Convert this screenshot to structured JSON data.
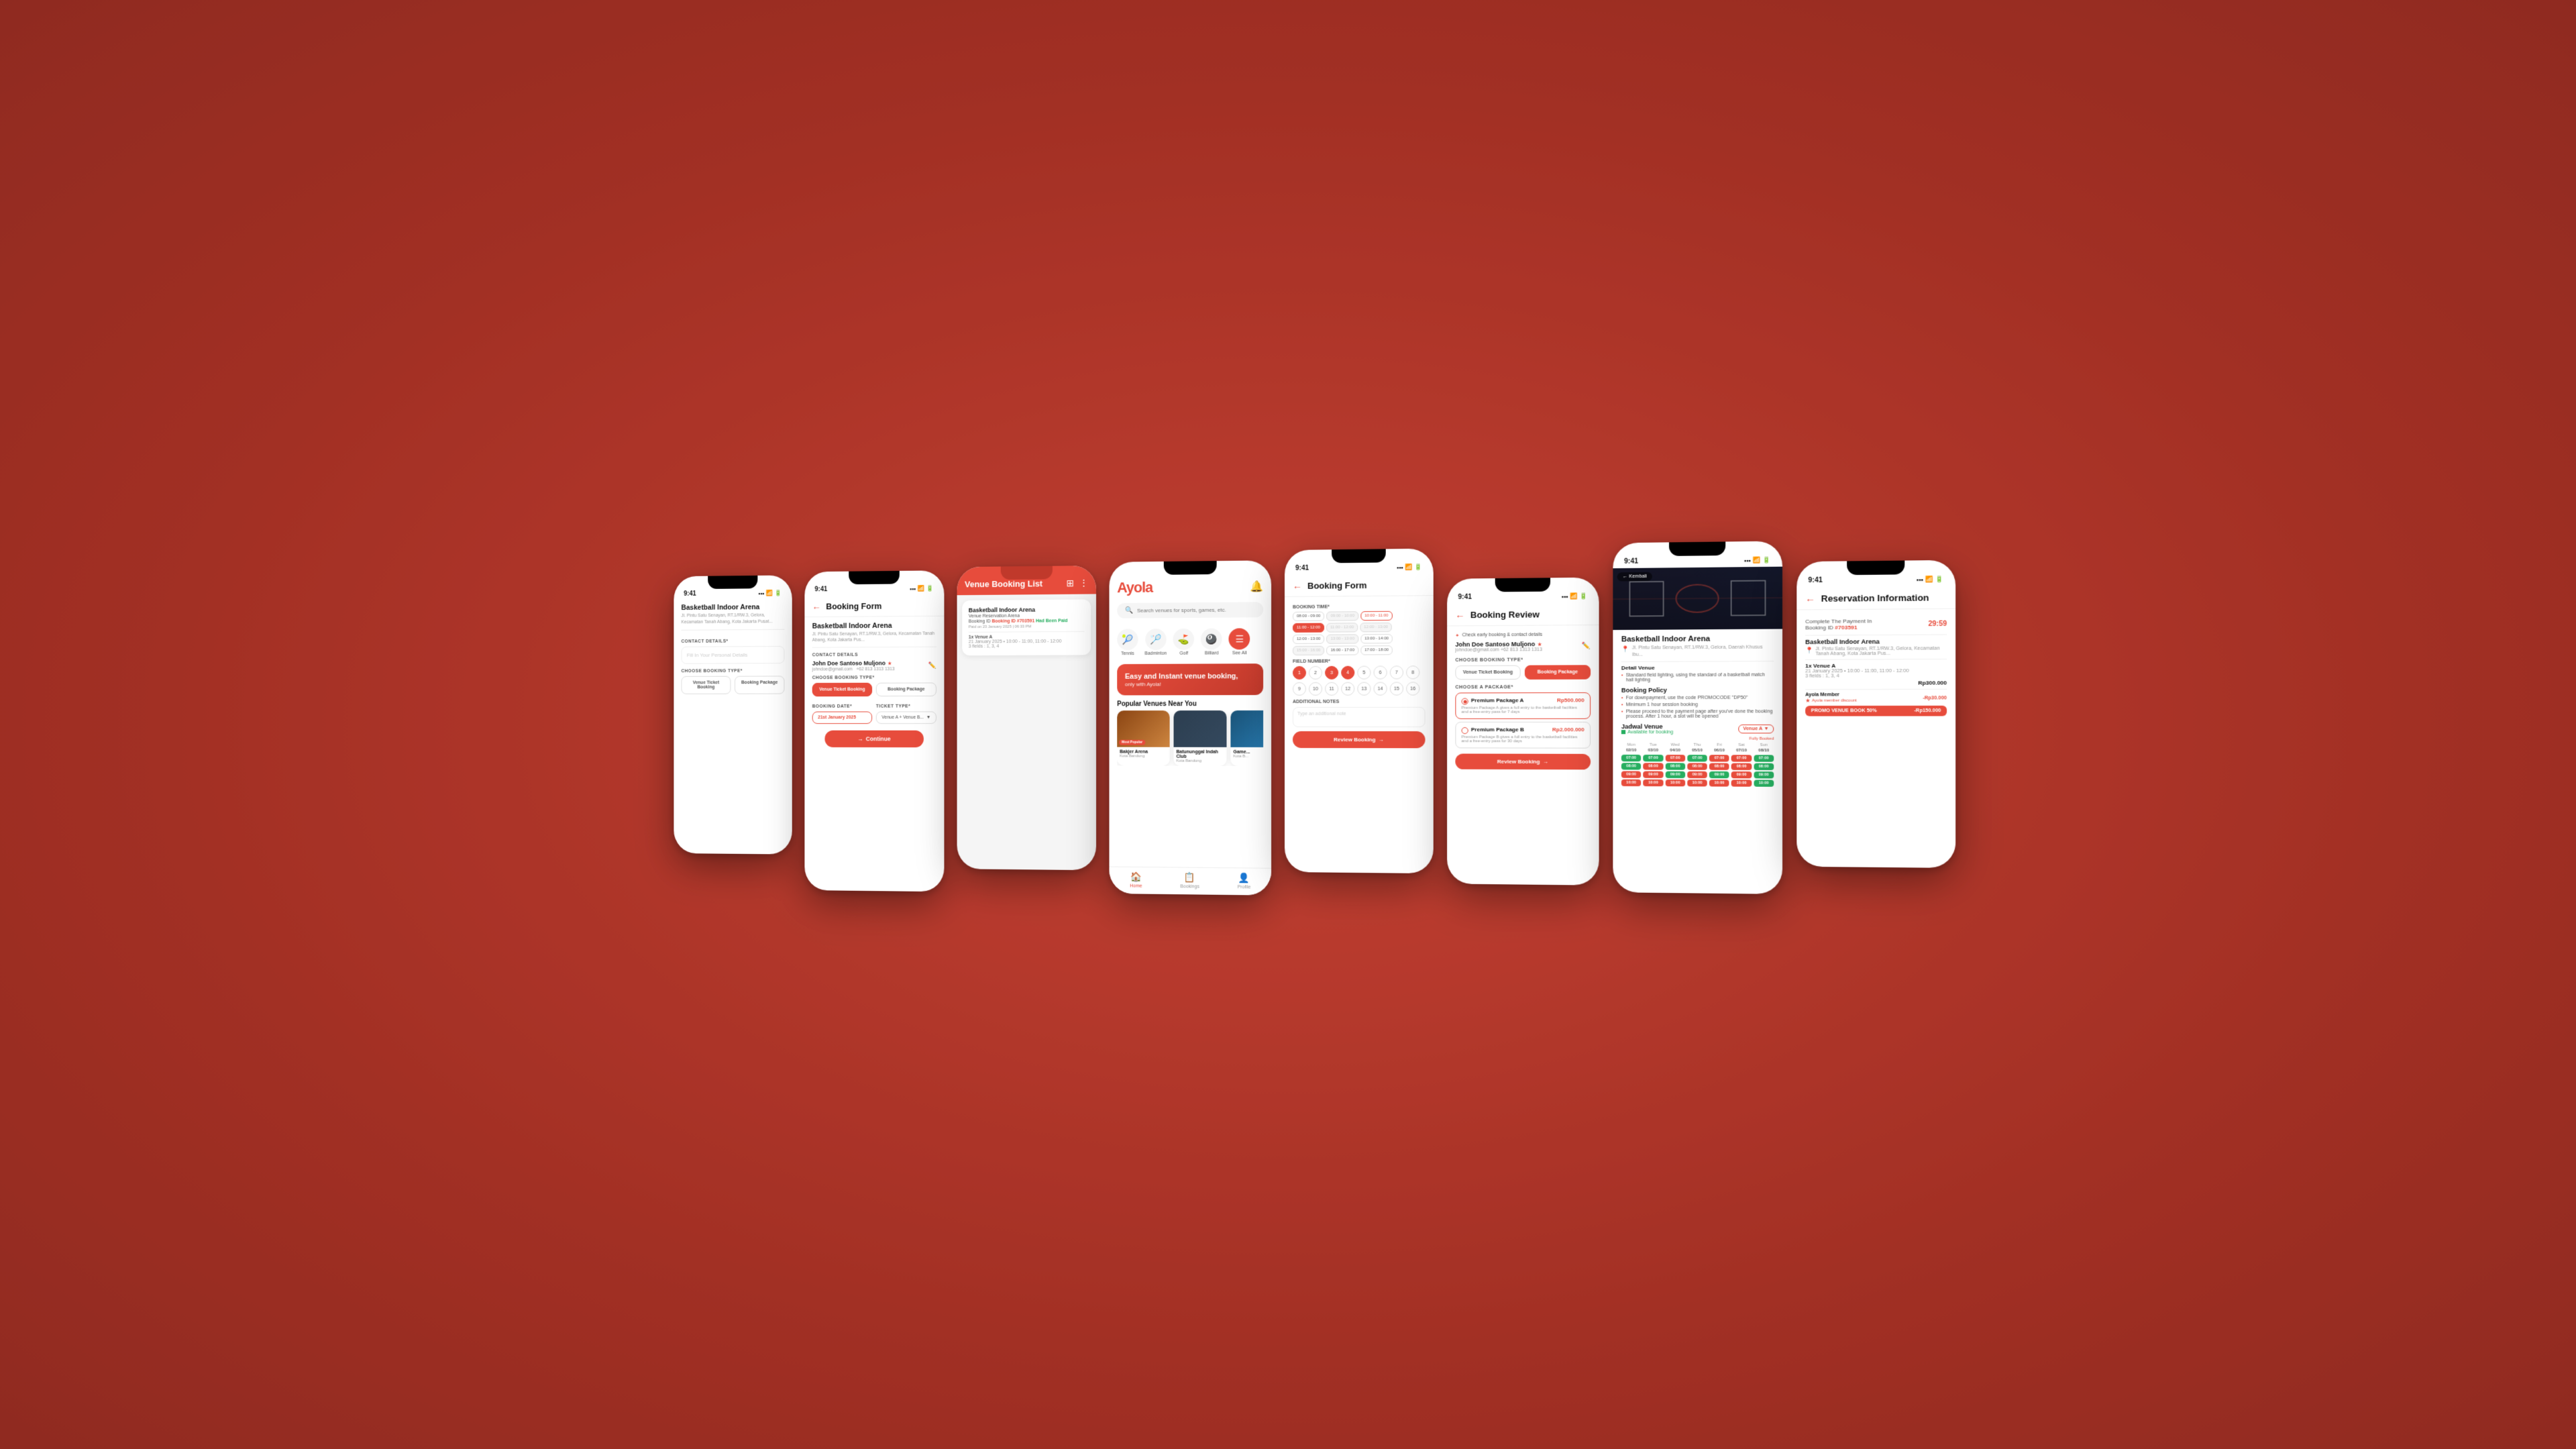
{
  "app": {
    "name": "Ayola",
    "tagline": "Easy and Instant venue booking, only with Ayola!",
    "time": "9:41",
    "accent_color": "#e74c3c"
  },
  "home_screen": {
    "search_placeholder": "Search venues for sports, games, etc.",
    "categories": [
      {
        "id": "tennis",
        "label": "Tennis",
        "icon": "🎾",
        "active": false
      },
      {
        "id": "badminton",
        "label": "Badminton",
        "icon": "🏸",
        "active": false
      },
      {
        "id": "golf",
        "label": "Golf",
        "icon": "⛳",
        "active": false
      },
      {
        "id": "billiard",
        "label": "Billiard",
        "icon": "🎱",
        "active": false
      },
      {
        "id": "see_all",
        "label": "See All",
        "icon": "☰",
        "active": true
      }
    ],
    "banner_title": "Easy and Instant venue booking,",
    "banner_subtitle": "only with Ayola!",
    "section_popular": "Popular Venues Near You",
    "venues": [
      {
        "name": "Bakjer Arena",
        "city": "Kota Bandung",
        "badge": "Most Popular",
        "img_class": "img1"
      },
      {
        "name": "Batununggal Indah Club",
        "city": "Kota Bandung",
        "img_class": "img2"
      },
      {
        "name": "Game...",
        "city": "Kota B...",
        "img_class": "img3"
      }
    ],
    "nav_items": [
      {
        "id": "home",
        "label": "Home",
        "icon": "🏠",
        "active": true
      },
      {
        "id": "bookings",
        "label": "Bookings",
        "icon": "📋",
        "active": false
      },
      {
        "id": "profile",
        "label": "Profile",
        "icon": "👤",
        "active": false
      }
    ]
  },
  "booking_form_1": {
    "title": "Booking Form",
    "venue_name": "Basketball Indoor Arena",
    "venue_address": "Jl. Pintu Satu Senayan, RT.1/RW.3, Gelora, Kecamatan Tanah Abang, Kota Jakarta Pus...",
    "section_contact": "CONTACT DETAILS",
    "contact_name": "John Doe Santoso Muljono",
    "contact_email": "johndoe@gmail.com",
    "contact_phone": "+62 813 1313 1313",
    "section_booking_type": "CHOOSE BOOKING TYPE*",
    "btn_venue_ticket": "Venue Ticket Booking",
    "btn_booking_package": "Booking Package",
    "btn_active": "Venue Ticket Booking",
    "section_booking_date": "BOOKING DATE*",
    "booking_date": "21st January 2025",
    "section_ticket_type": "TICKET TYPE*",
    "ticket_type": "Venue A + Venue B...",
    "continue_label": "Continue"
  },
  "booking_form_2": {
    "title": "Booking Form",
    "venue_name": "Basketball Indoor Arena",
    "venue_address": "Jl. Pintu Satu Senayan, RT.1/RW.3, Gelora, Kecamatan Tanah Abang, Kota Jakarta Pus...",
    "section_booking_time": "BOOKING TIME*",
    "time_slots": [
      {
        "label": "08:00 - 09:00",
        "state": "normal"
      },
      {
        "label": "09:00 - 10:00",
        "state": "disabled"
      },
      {
        "label": "10:00 - 11:00",
        "state": "selected"
      },
      {
        "label": "11:00 - 12:00",
        "state": "active"
      },
      {
        "label": "11:00 - 12:00",
        "state": "disabled"
      },
      {
        "label": "12:00 - 13:00",
        "state": "disabled"
      },
      {
        "label": "12:00 - 13:00",
        "state": "normal"
      },
      {
        "label": "13:00 - 13:00",
        "state": "disabled"
      },
      {
        "label": "13:00 - 14:00",
        "state": "normal"
      },
      {
        "label": "15:00 - 16:00",
        "state": "disabled"
      },
      {
        "label": "16:00 - 17:00",
        "state": "normal"
      },
      {
        "label": "17:00 - 18:00",
        "state": "normal"
      }
    ],
    "section_field_number": "FIELD NUMBER*",
    "fields": [
      "1",
      "2",
      "3",
      "4",
      "5",
      "6",
      "7",
      "8",
      "9",
      "10",
      "11",
      "12",
      "13",
      "14",
      "15",
      "16"
    ],
    "active_fields": [
      "1",
      "3",
      "4"
    ],
    "section_additional_notes": "ADDITIONAL NOTES",
    "notes_placeholder": "Type an additional note",
    "review_btn": "Review Booking"
  },
  "booking_review": {
    "title": "Booking Review",
    "check_text": "Check early booking & contact details",
    "contact_name": "John Doe Santoso Muljono",
    "contact_email": "johndoe@gmail.com",
    "contact_phone": "+62 813 1313 1313",
    "booking_type_label": "CHOOSE BOOKING TYPE*",
    "btn_venue_ticket": "Venue Ticket Booking",
    "btn_booking_package": "Booking Package",
    "package_label": "CHOOSE A PACKAGE*",
    "packages": [
      {
        "name": "Premium Package A",
        "price": "Rp500.000",
        "desc": "Premium Package A gives a full entry to the basketball facilities and a free-entry pass for 7 days",
        "selected": true
      },
      {
        "name": "Premium Package B",
        "price": "Rp2.000.000",
        "desc": "Premium Package B gives a full entry to the basketball facilities and a free-entry pass for 30 days",
        "selected": false
      }
    ],
    "review_btn": "Review Booking"
  },
  "reservation_info": {
    "title": "Reservation Information",
    "subtitle": "Complete The Payment In",
    "booking_id": "#703591",
    "countdown": "29:59",
    "venue_name": "Basketball Indoor Arena",
    "venue_address": "Jl. Pintu Satu Senayan, RT.1/RW.3, Gelora, Kecamatan Tanah Abang, Kota Jakarta Pus...",
    "items": [
      {
        "label": "1x Venue A",
        "detail": "21 January 2025 • 10:00 - 11:00, 11:00 - 12:00",
        "price": "Rp300.000",
        "fields": "3 fields : 1, 3, 4"
      }
    ],
    "member_discount_label": "Ayola Member",
    "member_discount_sub": "Ayola member discount",
    "member_discount_price": "-Rp30.000",
    "promo_label": "PROMO VENUE BOOK 50%",
    "promo_price": "-Rp150.000"
  },
  "venue_booking_list": {
    "title": "Venue Booking List",
    "bookings": [
      {
        "venue": "Basketball Indoor Arena",
        "type": "Venue Reservation Arena",
        "status": "Had Been Paid",
        "booking_id": "Booking ID #703591",
        "paid_date": "Paid on 23 January 2025 | 06:33 PM",
        "items": "1x Venue A",
        "detail": "21 January 2025 • 10:00 - 11:00, 11:00 - 12:00",
        "fields": "3 fields : 1, 3, 4"
      }
    ]
  },
  "venue_detail": {
    "title": "Detail Venue",
    "details": [
      "Standard field lighting, using the standard of a basketball match hall lighting"
    ],
    "policy_title": "Booking Policy",
    "policies": [
      "For downpayment, use the code PROMOCODE \"DP50\"",
      "Minimum 1 hour session booking",
      "Please proceed to the payment page after you've done the booking process. After 1 hour, a slot will be opened"
    ]
  },
  "venue_detail_main": {
    "kembali": "Kembali",
    "venue_name": "Basketball Indoor Arena",
    "venue_address": "Jl. Pintu Satu Senayan, RT.1/RW.3, Gelora, Daerah Khusus Ibu...",
    "schedule_title": "Jadwal Venue",
    "available": "Available for booking",
    "fully_booked": "Fully Booked",
    "venue_a": "Venue A",
    "days": [
      {
        "day": "Mon",
        "date": "02/10"
      },
      {
        "day": "Tue",
        "date": "03/10"
      },
      {
        "day": "Wed",
        "date": "04/10"
      },
      {
        "day": "Thu",
        "date": "05/10"
      },
      {
        "day": "Fri",
        "date": "06/10"
      },
      {
        "day": "Sat",
        "date": "07/10"
      },
      {
        "day": "Sun",
        "date": "08/10"
      }
    ],
    "time_labels": [
      "07:00",
      "08:00",
      "09:00",
      "10:00"
    ]
  },
  "first_booking_form": {
    "title": "Booking Form",
    "venue_name": "Basketball Indoor Arena",
    "venue_address": "Jl. Pintu Satu Senayan, RT.1/RW.3, Gelora, Kecamatan Tanah Abang, Kota Jakarta Pusat...",
    "fill_personal": "Fill In Your Personal Details",
    "contact_details": "CONTACT DETAILS*",
    "booking_type": "CHOOSE BOOKING TYPE*",
    "btn_venue": "Venue Ticket Booking",
    "btn_package": "Booking Package"
  }
}
